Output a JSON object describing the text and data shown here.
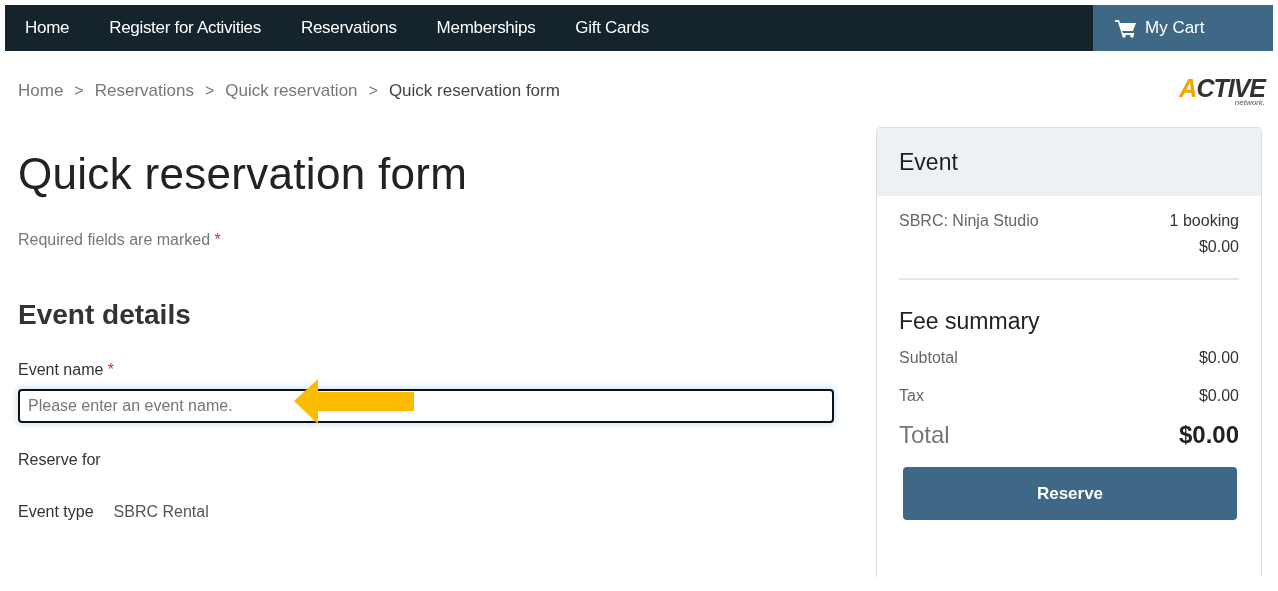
{
  "nav": {
    "items": [
      {
        "label": "Home"
      },
      {
        "label": "Register for Activities"
      },
      {
        "label": "Reservations"
      },
      {
        "label": "Memberships"
      },
      {
        "label": "Gift Cards"
      }
    ],
    "cart": "My Cart"
  },
  "breadcrumb": {
    "items": [
      "Home",
      "Reservations",
      "Quick reservation",
      "Quick reservation form"
    ],
    "separators": [
      ">",
      ">",
      ">"
    ]
  },
  "logo": {
    "wordmark": "ACTIVE",
    "tagline": "network."
  },
  "title": "Quick reservation form",
  "required_note": {
    "text": "Required fields are marked",
    "marker": "*"
  },
  "section_heading": "Event details",
  "event_name": {
    "label": "Event name",
    "marker": "*",
    "placeholder": "Please enter an event name."
  },
  "reserve_for": {
    "label": "Reserve for"
  },
  "event_type": {
    "label": "Event type",
    "value": "SBRC Rental"
  },
  "summary": {
    "header": "Event",
    "items": [
      {
        "name": "SBRC: Ninja Studio",
        "count": "1 booking",
        "price": "$0.00"
      }
    ],
    "fee_heading": "Fee summary",
    "lines": [
      {
        "label": "Subtotal",
        "amount": "$0.00"
      },
      {
        "label": "Tax",
        "amount": "$0.00"
      }
    ],
    "total": {
      "label": "Total",
      "amount": "$0.00"
    },
    "button": "Reserve"
  }
}
